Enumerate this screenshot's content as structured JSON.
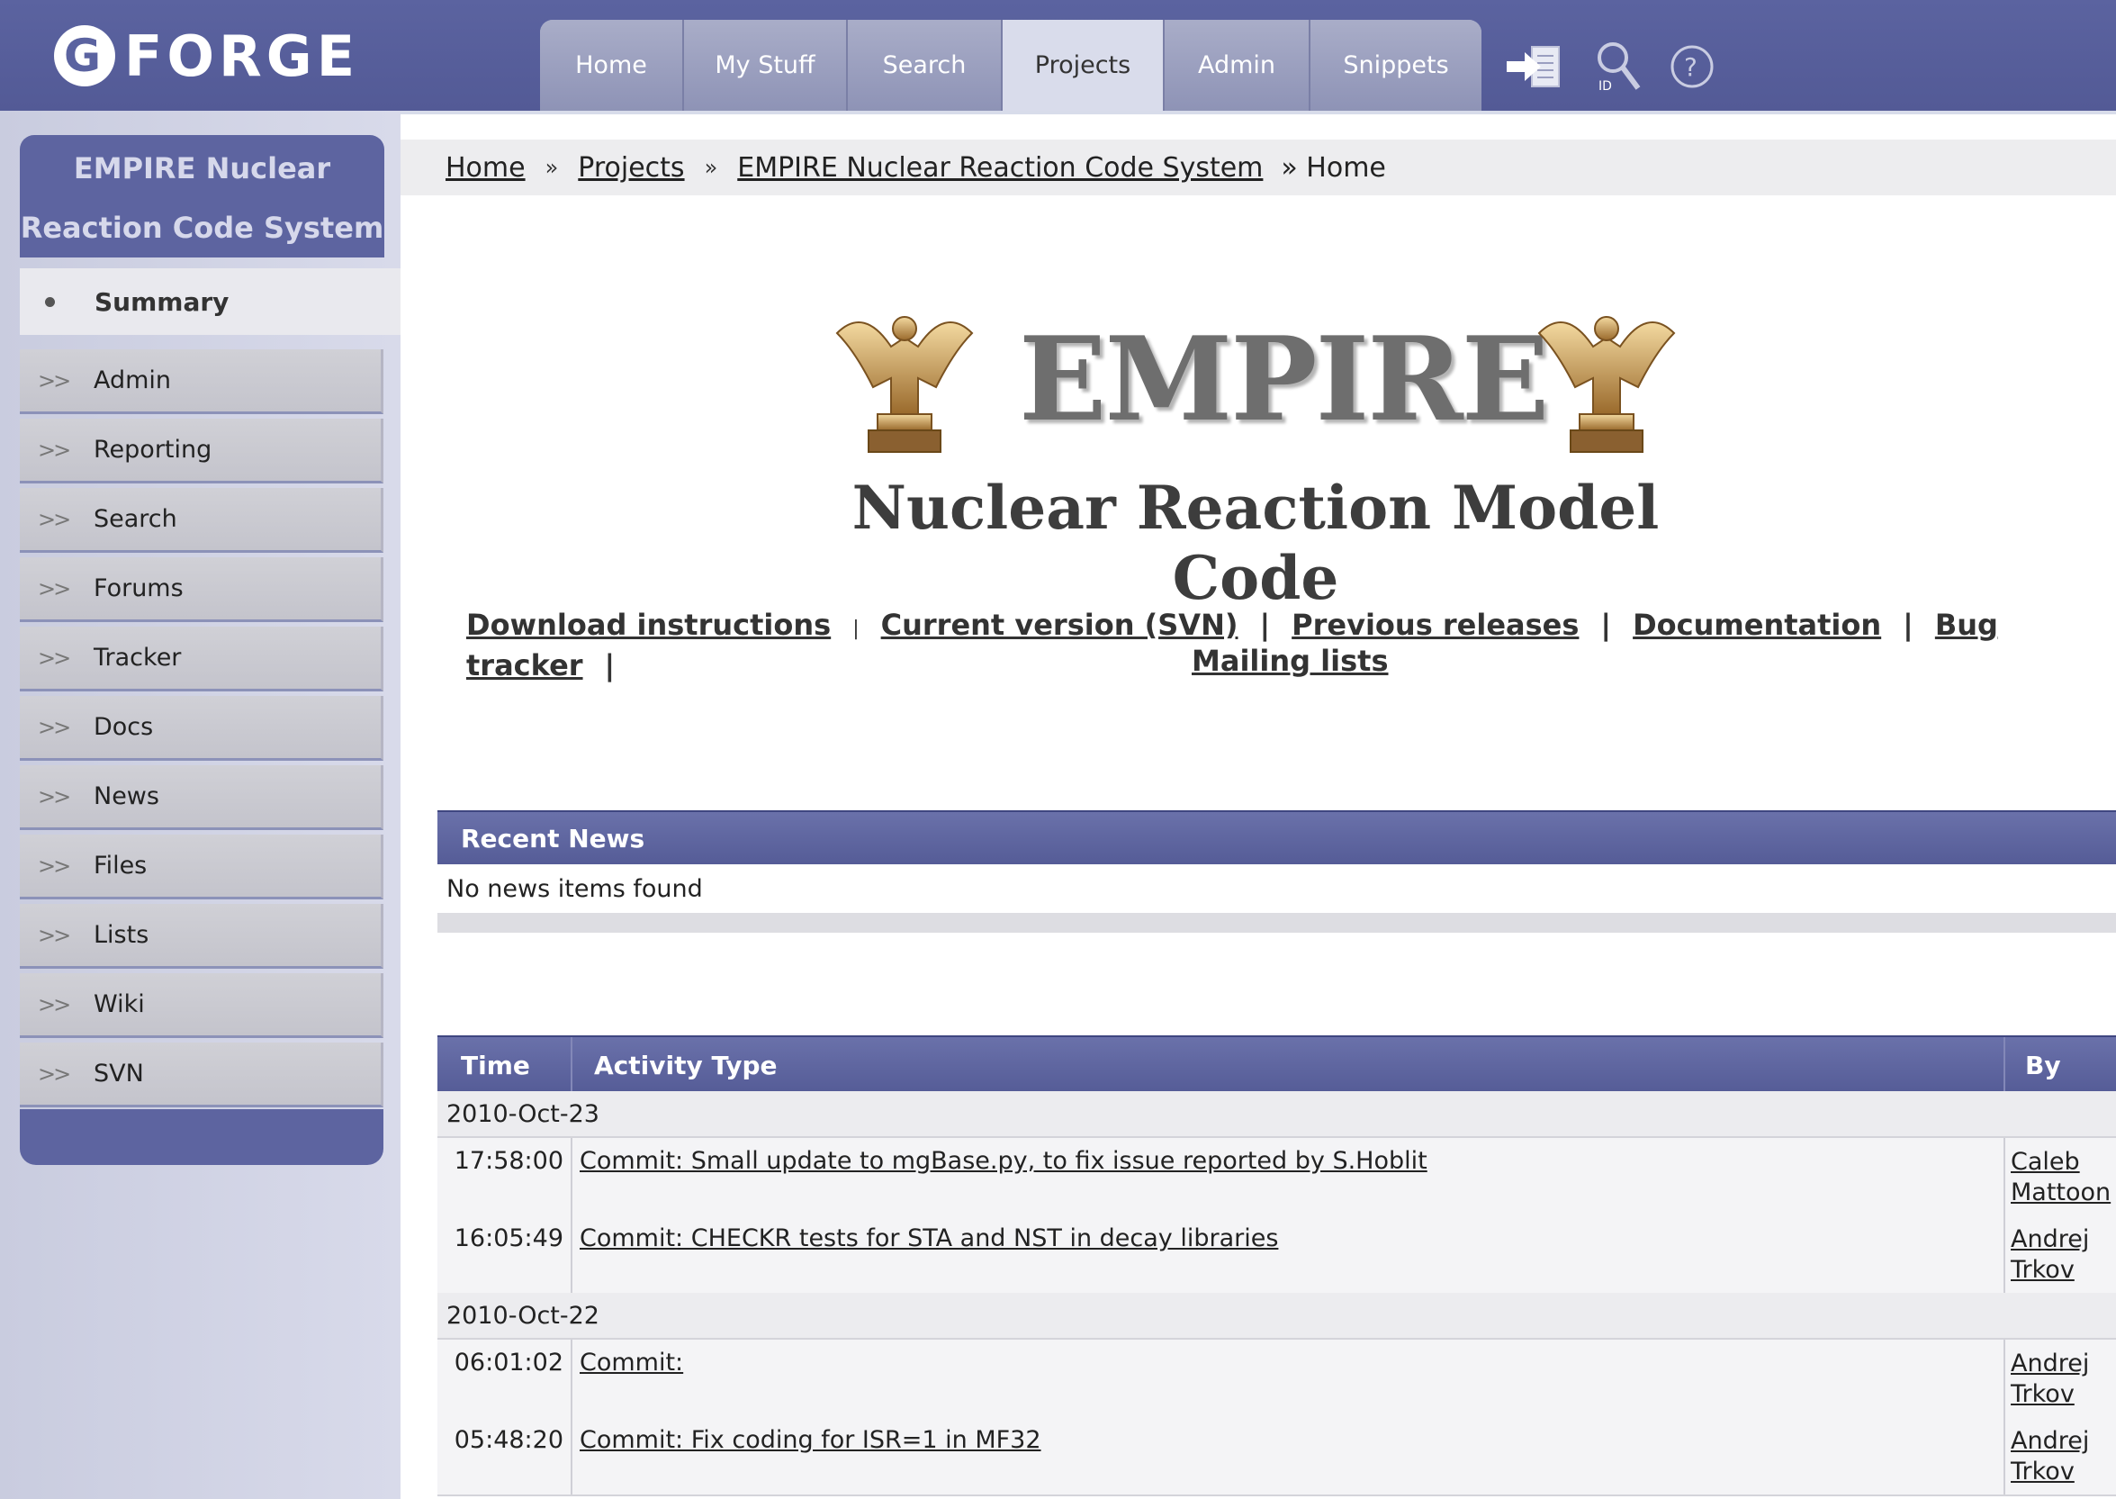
{
  "logo": {
    "text": "FORGE"
  },
  "nav_tabs": [
    {
      "label": "Home"
    },
    {
      "label": "My Stuff"
    },
    {
      "label": "Search"
    },
    {
      "label": "Projects",
      "active": true
    },
    {
      "label": "Admin"
    },
    {
      "label": "Snippets"
    }
  ],
  "toolbar_icons": [
    "login-arrow-icon",
    "id-search-icon",
    "help-icon"
  ],
  "sidebar": {
    "title": "EMPIRE Nuclear Reaction Code System",
    "summary_label": "Summary",
    "items": [
      {
        "label": "Admin"
      },
      {
        "label": "Reporting"
      },
      {
        "label": "Search"
      },
      {
        "label": "Forums"
      },
      {
        "label": "Tracker"
      },
      {
        "label": "Docs"
      },
      {
        "label": "News"
      },
      {
        "label": "Files"
      },
      {
        "label": "Lists"
      },
      {
        "label": "Wiki"
      },
      {
        "label": "SVN"
      }
    ]
  },
  "breadcrumb": {
    "home": "Home",
    "projects": "Projects",
    "project": "EMPIRE Nuclear Reaction Code System",
    "current": "» Home",
    "sep": "»"
  },
  "banner": {
    "title": "EMPIRE",
    "subtitle": "Nuclear Reaction Model Code"
  },
  "links": {
    "download": "Download instructions",
    "current": "Current version (SVN)",
    "previous": "Previous releases",
    "documentation": "Documentation",
    "bugtracker": "Bug tracker",
    "mailing": "Mailing lists"
  },
  "news": {
    "header": "Recent News",
    "empty": "No news items found"
  },
  "activity": {
    "col_time": "Time",
    "col_type": "Activity Type",
    "col_by": "By",
    "dates": [
      "2010-Oct-23",
      "2010-Oct-22"
    ],
    "rows": [
      {
        "time": "17:58:00",
        "desc": "Commit: Small update to mgBase.py, to fix issue reported by S.Hoblit",
        "by_first": "Caleb",
        "by_last": "Mattoon"
      },
      {
        "time": "16:05:49",
        "desc": "Commit: CHECKR tests for STA and NST in decay libraries",
        "by_first": "Andrej",
        "by_last": "Trkov"
      },
      {
        "time": "06:01:02",
        "desc": "Commit:",
        "by_first": "Andrej",
        "by_last": "Trkov"
      },
      {
        "time": "05:48:20",
        "desc": "Commit: Fix coding for ISR=1 in MF32",
        "by_first": "Andrej",
        "by_last": "Trkov"
      }
    ]
  },
  "colors": {
    "nav_bg": "#5b63a0",
    "tab_inactive": "#9a9ec0",
    "tab_active": "#d9dceb",
    "sidebar_bg": "#cfd1e4",
    "table_header": "#5f66a1"
  }
}
